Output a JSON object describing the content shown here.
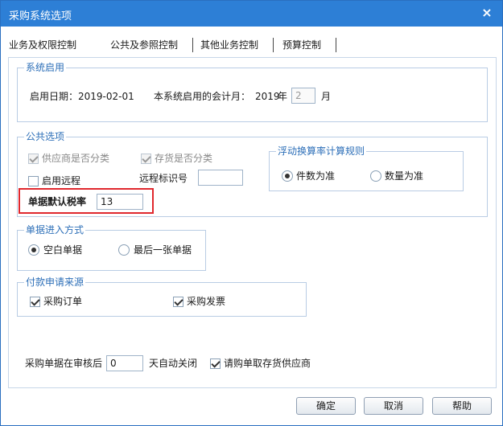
{
  "window": {
    "title": "采购系统选项",
    "close_glyph": "×"
  },
  "tabs": [
    {
      "label": "业务及权限控制"
    },
    {
      "label": "公共及参照控制"
    },
    {
      "label": "其他业务控制"
    },
    {
      "label": "预算控制"
    }
  ],
  "system_start": {
    "legend": "系统启用",
    "start_date_label": "启用日期：",
    "start_date_value": "2019-02-01",
    "accounting_month_label": "本系统启用的会计月：",
    "year_value": "2019",
    "year_unit": "年",
    "month_value": "2",
    "month_unit": "月"
  },
  "common_options": {
    "legend": "公共选项",
    "supplier_classified": {
      "label": "供应商是否分类",
      "checked": true,
      "enabled": false
    },
    "inventory_classified": {
      "label": "存货是否分类",
      "checked": true,
      "enabled": false
    },
    "enable_remote": {
      "label": "启用远程",
      "checked": false
    },
    "remote_id_label": "远程标识号",
    "remote_id_value": "",
    "default_tax_label": "单据默认税率",
    "default_tax_value": "13",
    "float_rate": {
      "legend": "浮动换算率计算规则",
      "by_piece": {
        "label": "件数为准",
        "selected": true
      },
      "by_quantity": {
        "label": "数量为准",
        "selected": false
      }
    }
  },
  "document_entry": {
    "legend": "单据进入方式",
    "blank": {
      "label": "空白单据",
      "selected": true
    },
    "last": {
      "label": "最后一张单据",
      "selected": false
    }
  },
  "payment_source": {
    "legend": "付款申请来源",
    "purchase_order": {
      "label": "采购订单",
      "checked": true
    },
    "purchase_invoice": {
      "label": "采购发票",
      "checked": true
    }
  },
  "auto_close": {
    "prefix": "采购单据在审核后",
    "days_value": "0",
    "suffix": "天自动关闭",
    "requisition_supplier": {
      "label": "请购单取存货供应商",
      "checked": true
    }
  },
  "buttons": {
    "ok": "确定",
    "cancel": "取消",
    "help": "帮助"
  },
  "colors": {
    "titlebar": "#2d7fd6",
    "legend_text": "#2d6fb8",
    "highlight": "#e0282d"
  }
}
